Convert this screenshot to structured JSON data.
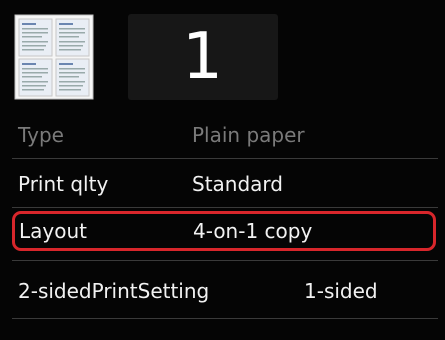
{
  "copies": {
    "value": "1"
  },
  "settings": [
    {
      "label": "Type",
      "value": "Plain paper"
    },
    {
      "label": "Print qlty",
      "value": "Standard"
    },
    {
      "label": "Layout",
      "value": "4-on-1 copy"
    },
    {
      "label": "2-sidedPrintSetting",
      "value": "1-sided"
    }
  ],
  "colors": {
    "highlight": "#d8262b",
    "background": "#050505",
    "text": "#f2f2f2"
  },
  "icons": {
    "preview": "layout-4on1-preview-icon"
  }
}
